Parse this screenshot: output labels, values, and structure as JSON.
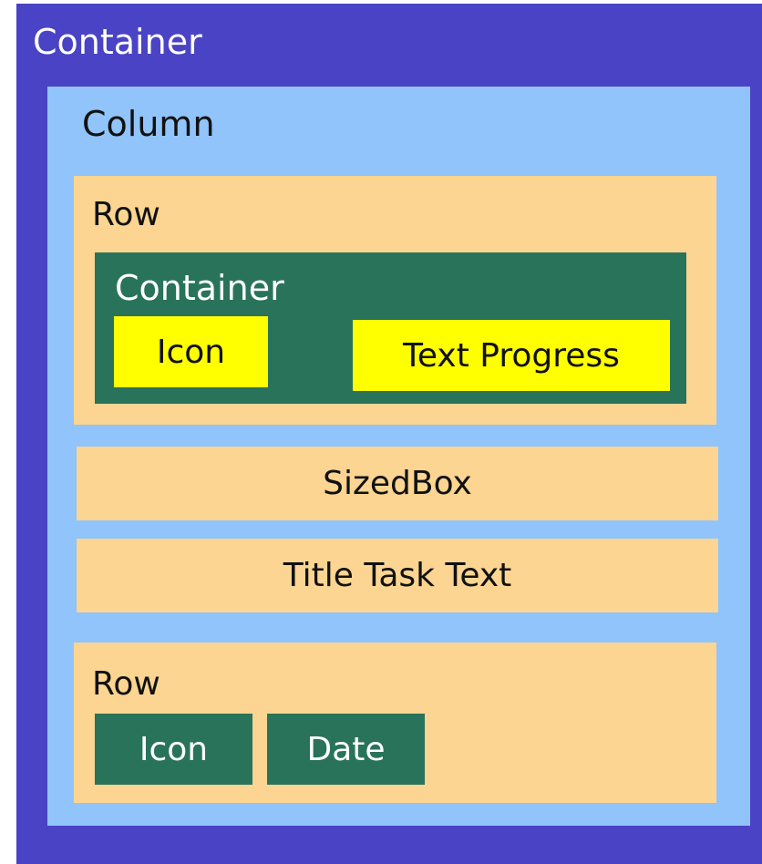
{
  "outer": {
    "label": "Container"
  },
  "column": {
    "label": "Column"
  },
  "row_top": {
    "label": "Row",
    "inner": {
      "label": "Container",
      "icon": "Icon",
      "text_progress": "Text Progress"
    }
  },
  "sizedbox": {
    "label": "SizedBox"
  },
  "title_task": {
    "label": "Title Task Text"
  },
  "row_bottom": {
    "label": "Row",
    "icon": "Icon",
    "date": "Date"
  },
  "colors": {
    "container_outer": "#4a43c5",
    "column": "#90c4fb",
    "row": "#fbd591",
    "container_inner": "#29735b",
    "highlight": "#ffff00"
  }
}
